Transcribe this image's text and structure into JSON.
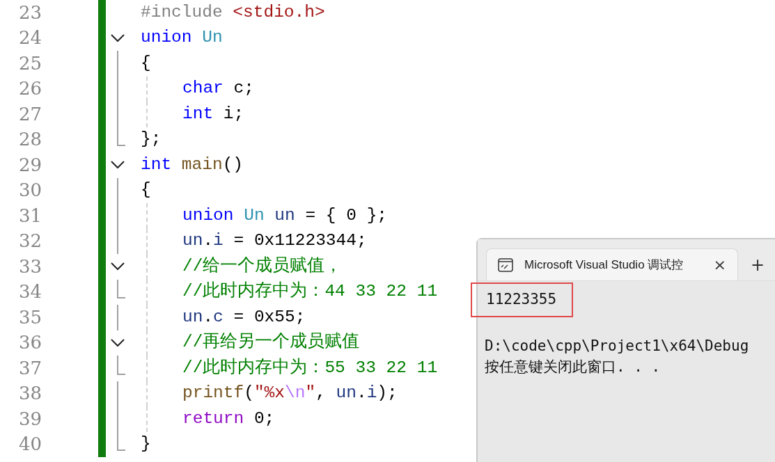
{
  "editor": {
    "lines": [
      {
        "number": "23",
        "kind": "plain",
        "indented": false,
        "tokens": [
          {
            "kind": "preproc",
            "text": "#include "
          },
          {
            "kind": "string",
            "text": "<stdio.h>"
          }
        ]
      },
      {
        "number": "24",
        "kind": "fold",
        "expanded": true,
        "indented": false,
        "tokens": [
          {
            "kind": "keyword",
            "text": "union"
          },
          {
            "kind": "type",
            "text": " Un"
          }
        ]
      },
      {
        "number": "25",
        "kind": "guide",
        "indented": false,
        "tokens": [
          {
            "kind": "plain",
            "text": "{"
          }
        ]
      },
      {
        "number": "26",
        "kind": "guide",
        "indented": true,
        "tokens": [
          {
            "kind": "keyword",
            "text": "char"
          },
          {
            "kind": "plain",
            "text": " c;"
          }
        ]
      },
      {
        "number": "27",
        "kind": "guide",
        "indented": true,
        "tokens": [
          {
            "kind": "keyword",
            "text": "int"
          },
          {
            "kind": "plain",
            "text": " i;"
          }
        ]
      },
      {
        "number": "28",
        "kind": "end",
        "indented": false,
        "tokens": [
          {
            "kind": "plain",
            "text": "};"
          }
        ]
      },
      {
        "number": "29",
        "kind": "fold",
        "expanded": true,
        "indented": false,
        "tokens": [
          {
            "kind": "keyword",
            "text": "int"
          },
          {
            "kind": "function",
            "text": " main"
          },
          {
            "kind": "plain",
            "text": "()"
          }
        ]
      },
      {
        "number": "30",
        "kind": "guide",
        "indented": false,
        "tokens": [
          {
            "kind": "plain",
            "text": "{"
          }
        ]
      },
      {
        "number": "31",
        "kind": "guide",
        "indented": true,
        "tokens": [
          {
            "kind": "keyword",
            "text": "union"
          },
          {
            "kind": "type",
            "text": " Un"
          },
          {
            "kind": "variable",
            "text": " un"
          },
          {
            "kind": "plain",
            "text": " = { 0 };"
          }
        ]
      },
      {
        "number": "32",
        "kind": "guide",
        "indented": true,
        "tokens": [
          {
            "kind": "variable",
            "text": "un"
          },
          {
            "kind": "plain",
            "text": "."
          },
          {
            "kind": "variable",
            "text": "i"
          },
          {
            "kind": "plain",
            "text": " = 0x11223344;"
          }
        ]
      },
      {
        "number": "33",
        "kind": "fold",
        "expanded": true,
        "indented": true,
        "tokens": [
          {
            "kind": "comment",
            "text": "//给一个成员赋值，"
          }
        ]
      },
      {
        "number": "34",
        "kind": "end",
        "indented": true,
        "tokens": [
          {
            "kind": "comment",
            "text": "//此时内存中为：44 33 22 11"
          }
        ]
      },
      {
        "number": "35",
        "kind": "guide",
        "indented": true,
        "tokens": [
          {
            "kind": "variable",
            "text": "un"
          },
          {
            "kind": "plain",
            "text": "."
          },
          {
            "kind": "variable",
            "text": "c"
          },
          {
            "kind": "plain",
            "text": " = 0x55;"
          }
        ]
      },
      {
        "number": "36",
        "kind": "fold",
        "expanded": true,
        "indented": true,
        "tokens": [
          {
            "kind": "comment",
            "text": "//再给另一个成员赋值"
          }
        ]
      },
      {
        "number": "37",
        "kind": "end",
        "indented": true,
        "tokens": [
          {
            "kind": "comment",
            "text": "//此时内存中为：55 33 22 11"
          }
        ]
      },
      {
        "number": "38",
        "kind": "guide",
        "indented": true,
        "tokens": [
          {
            "kind": "function",
            "text": "printf"
          },
          {
            "kind": "plain",
            "text": "("
          },
          {
            "kind": "string",
            "text": "\"%x"
          },
          {
            "kind": "escape",
            "text": "\\n"
          },
          {
            "kind": "string",
            "text": "\""
          },
          {
            "kind": "plain",
            "text": ", "
          },
          {
            "kind": "variable",
            "text": "un"
          },
          {
            "kind": "plain",
            "text": "."
          },
          {
            "kind": "variable",
            "text": "i"
          },
          {
            "kind": "plain",
            "text": ");"
          }
        ]
      },
      {
        "number": "39",
        "kind": "guide",
        "indented": true,
        "tokens": [
          {
            "kind": "control",
            "text": "return"
          },
          {
            "kind": "plain",
            "text": " 0;"
          }
        ]
      },
      {
        "number": "40",
        "kind": "end",
        "indented": false,
        "tokens": [
          {
            "kind": "plain",
            "text": "}"
          }
        ]
      }
    ]
  },
  "console": {
    "tab": {
      "title": "Microsoft Visual Studio 调试控",
      "close": "×",
      "selected": true
    },
    "new_tab": "+",
    "output": [
      {
        "text": "11223355",
        "highlighted": true
      }
    ],
    "lines": [
      "D:\\code\\cpp\\Project1\\x64\\Debug",
      "按任意键关闭此窗口. . ."
    ]
  }
}
